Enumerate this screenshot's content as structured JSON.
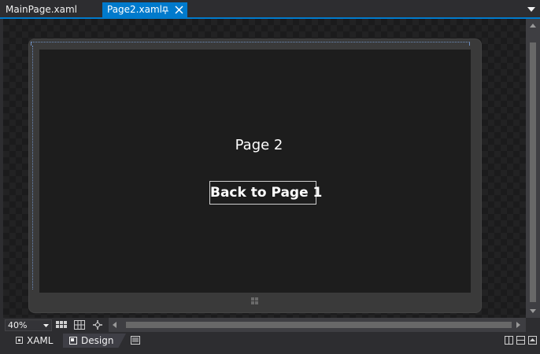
{
  "tabs": [
    {
      "label": "MainPage.xaml",
      "active": false
    },
    {
      "label": "Page2.xaml",
      "active": true
    }
  ],
  "icons": {
    "tab_pin": "pin-icon",
    "tab_close": "close-icon",
    "tab_overflow": "chevron-down-icon",
    "windows_button": "windows-logo-icon"
  },
  "designer": {
    "page_title": "Page 2",
    "back_button_label": "Back to Page 1"
  },
  "toolbar": {
    "zoom": "40%",
    "tools": [
      "grid-icon",
      "snap-grid-icon",
      "snap-lines-icon"
    ]
  },
  "view_tabs": [
    {
      "label": "XAML",
      "icon": "xaml-view-icon",
      "active": false
    },
    {
      "label": "Design",
      "icon": "design-view-icon",
      "active": true
    }
  ],
  "colors": {
    "accent": "#007acc",
    "background": "#2d2d30",
    "surface": "#1d1d1d",
    "device": "#3a3a3a"
  }
}
